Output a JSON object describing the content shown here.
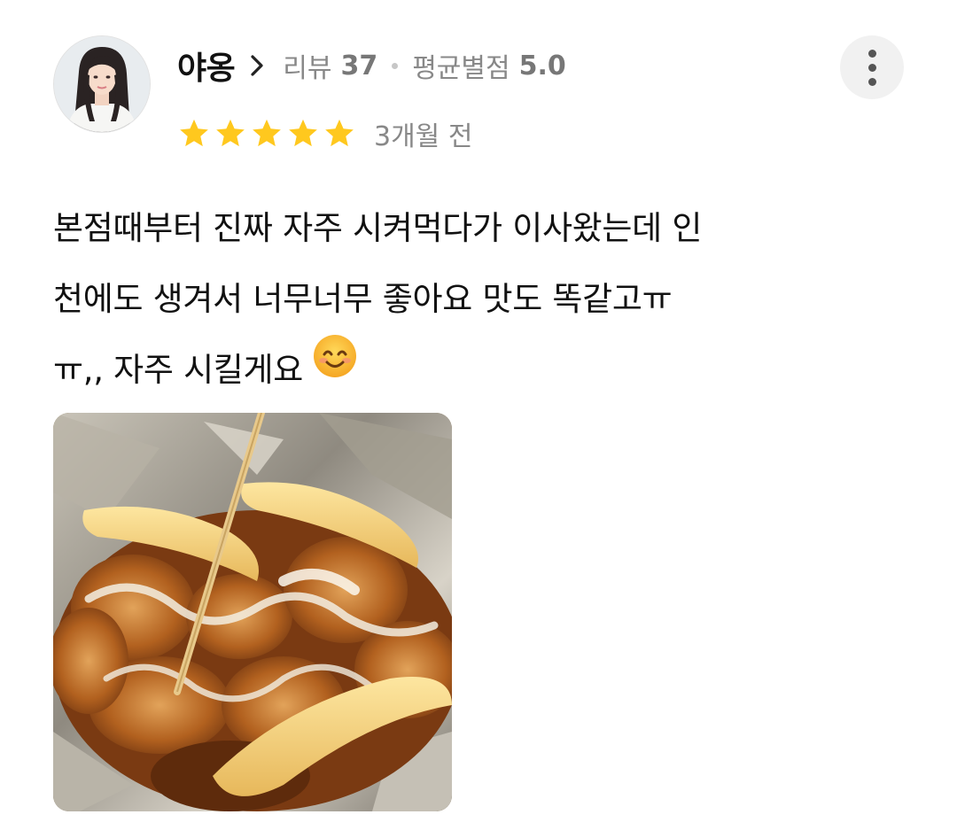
{
  "review": {
    "nickname": "야옹",
    "review_count_label": "리뷰",
    "review_count": "37",
    "avg_rating_label": "평균별점",
    "avg_rating": "5.0",
    "rating_stars": 5,
    "time_ago": "3개월 전",
    "text_lines": [
      "본점때부터 진짜 자주 시켜먹다가 이사왔는데 인",
      "천에도 생겨서 너무너무 좋아요 맛도 똑같고ㅠ",
      "ㅠ,, 자주 시킬게요"
    ],
    "emoji": "smiling-face-with-smiling-eyes"
  },
  "icons": {
    "chevron": "chevron-right-icon",
    "more": "more-vertical-icon",
    "star": "star-icon"
  },
  "colors": {
    "star": "#FFC81E",
    "meta_text": "#888888",
    "text": "#111111",
    "more_button_bg": "#F1F1F1"
  }
}
